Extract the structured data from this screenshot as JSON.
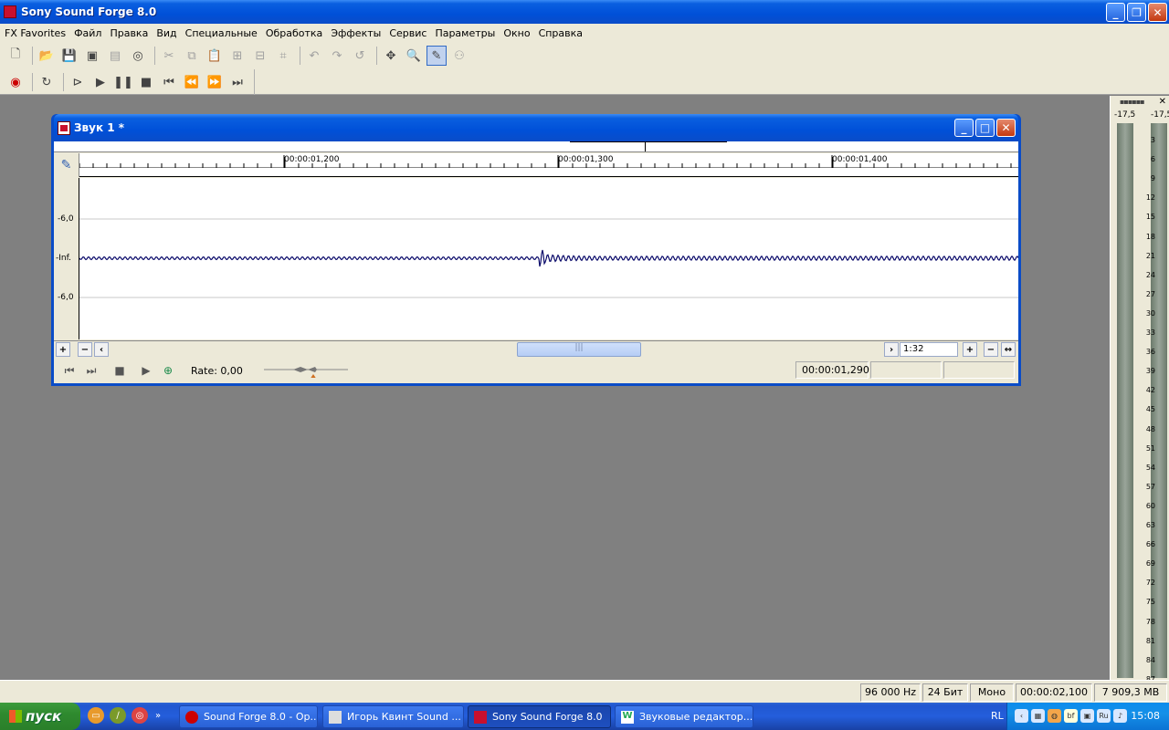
{
  "app": {
    "title": "Sony Sound Forge 8.0"
  },
  "menu": [
    "FX Favorites",
    "Файл",
    "Правка",
    "Вид",
    "Специальные",
    "Обработка",
    "Эффекты",
    "Сервис",
    "Параметры",
    "Окно",
    "Справка"
  ],
  "document": {
    "title": "Звук 1 *",
    "ruler_labels": [
      "00:00:01,200",
      "00:00:01,300",
      "00:00:01,400"
    ],
    "db_labels": [
      "-6,0",
      "-Inf.",
      "-6,0"
    ],
    "zoom": "1:32",
    "rate": "Rate: 0,00",
    "cursor_time": "00:00:01,290"
  },
  "meters": {
    "peak_left": "-17,5",
    "peak_right": "-17,5",
    "ticks": [
      "3",
      "6",
      "9",
      "12",
      "15",
      "18",
      "21",
      "24",
      "27",
      "30",
      "33",
      "36",
      "39",
      "42",
      "45",
      "48",
      "51",
      "54",
      "57",
      "60",
      "63",
      "66",
      "69",
      "72",
      "75",
      "78",
      "81",
      "84",
      "87"
    ]
  },
  "statusbar": {
    "sample_rate": "96 000 Hz",
    "bit_depth": "24 Бит",
    "channels": "Моно",
    "length": "00:00:02,100",
    "free_space": "7 909,3 MB"
  },
  "taskbar": {
    "start_label": "пуск",
    "tasks": [
      "Sound Forge 8.0 - Op...",
      "Игорь Квинт Sound ...",
      "Sony Sound Forge 8.0",
      "Звуковые редактор..."
    ],
    "lang": "RL",
    "time": "15:08"
  },
  "colors": {
    "title_blue": "#0050d8",
    "waveform": "#0a0a6a",
    "start_green": "#2f8a2f"
  }
}
